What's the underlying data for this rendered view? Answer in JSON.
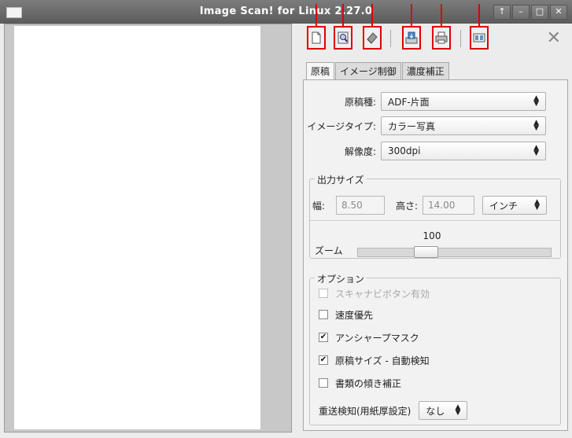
{
  "window": {
    "title": "Image Scan! for Linux 2.27.0"
  },
  "toolbar": {
    "buttons": [
      "new-document",
      "preview",
      "auto-detect",
      "scan",
      "print",
      "thumbnails"
    ]
  },
  "tabs": [
    "原稿",
    "イメージ制御",
    "濃度補正"
  ],
  "document": {
    "source_label": "原稿種:",
    "source_value": "ADF-片面",
    "image_type_label": "イメージタイプ:",
    "image_type_value": "カラー写真",
    "resolution_label": "解像度:",
    "resolution_value": "300dpi"
  },
  "output_size": {
    "title": "出力サイズ",
    "width_label": "幅:",
    "width_value": "8.50",
    "height_label": "高さ:",
    "height_value": "14.00",
    "unit_value": "インチ"
  },
  "zoom": {
    "label": "ズーム",
    "value": "100"
  },
  "options": {
    "title": "オプション",
    "scanner_button": {
      "label": "スキャナビボタン有効",
      "checked": false,
      "enabled": false
    },
    "speed_priority": {
      "label": "速度優先",
      "checked": false
    },
    "unsharp_mask": {
      "label": "アンシャープマスク",
      "checked": true
    },
    "auto_size": {
      "label": "原稿サイズ - 自動検知",
      "checked": true
    },
    "deskew": {
      "label": "書類の傾き補正",
      "checked": false
    },
    "double_feed_label": "重送検知(用紙厚設定)",
    "double_feed_value": "なし"
  }
}
